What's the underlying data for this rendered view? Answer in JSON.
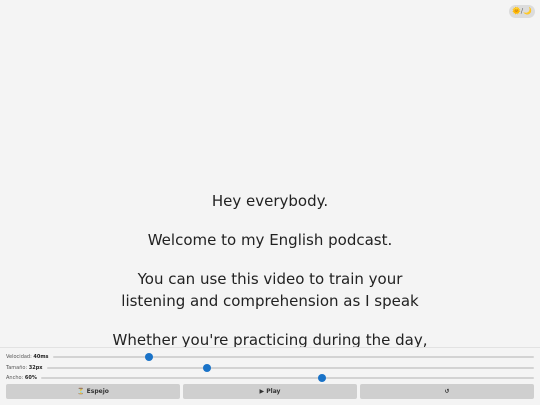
{
  "theme_toggle": {
    "label": "🌞/🌙"
  },
  "script_lines": [
    "Hey everybody.",
    "Welcome to my English podcast.",
    "You can use this video to train your listening and comprehension as I speak",
    "Whether you're practicing during the day,"
  ],
  "controls": {
    "speed": {
      "label": "Velocidad:",
      "value": "40ms",
      "level": 0.2
    },
    "size": {
      "label": "Tamaño:",
      "value": "32px",
      "level": 0.33
    },
    "width": {
      "label": "Ancho:",
      "value": "60%",
      "level": 0.57
    }
  },
  "buttons": {
    "mirror": "⏳ Espejo",
    "play": "▶ Play",
    "reset": "↺"
  },
  "colors": {
    "accent": "#1a73c8",
    "background": "#f4f4f4"
  }
}
